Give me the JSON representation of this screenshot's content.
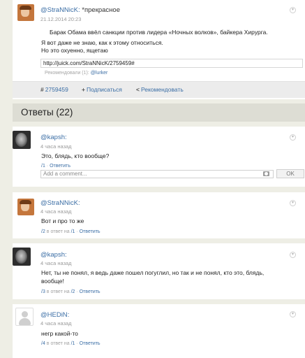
{
  "post": {
    "username": "@StraNNicK",
    "colon": ":",
    "tags": "*прекрасное",
    "date": "21.12.2014 20:23",
    "line1": "Барак Обама ввёл санкции против лидера «Ночных волков», байкера Хирурга.",
    "line2": "Я вот даже не знаю, как к этому относиться.",
    "line3": "Но это охуенно, ящетаю",
    "url": "http://juick.com/StraNNicK/2759459#",
    "recommended_prefix": "Рекомендовали (1):",
    "recommended_user": "@lurker",
    "actions": {
      "id_label": "2759459",
      "subscribe_label": "Подписаться",
      "recommend_label": "Рекомендовать"
    }
  },
  "answers_header": "Ответы (22)",
  "comments": [
    {
      "username": "@kapsh",
      "colon": ":",
      "time": "4 часа назад",
      "text": "Это, блядь, кто вообще?",
      "num": "/1",
      "reply_label": "Ответить",
      "placeholder": "Add a comment...",
      "ok_label": "OK"
    },
    {
      "username": "@StraNNicK",
      "colon": ":",
      "time": "4 часа назад",
      "text": "Вот и про то же",
      "num": "/2",
      "in_reply_prefix": "в ответ на",
      "in_reply_to": "/1",
      "reply_label": "Ответить"
    },
    {
      "username": "@kapsh",
      "colon": ":",
      "time": "4 часа назад",
      "text_line1": "Нет, ты не понял, я ведь даже пошел погуглил, но так и не понял, кто это, блядь,",
      "text_line2": "вообще!",
      "num": "/3",
      "in_reply_prefix": "в ответ на",
      "in_reply_to": "/2",
      "reply_label": "Ответить"
    },
    {
      "username": "@HEDiN",
      "colon": ":",
      "time": "4 часа назад",
      "text": "негр какой-то",
      "num": "/4",
      "in_reply_prefix": "в ответ на",
      "in_reply_to": "/1",
      "reply_label": "Ответить"
    }
  ],
  "icons": {
    "chevron": "chevron-down-icon",
    "id": "hash-icon",
    "subscribe": "plus-icon",
    "recommend": "share-icon",
    "camera": "camera-icon"
  }
}
